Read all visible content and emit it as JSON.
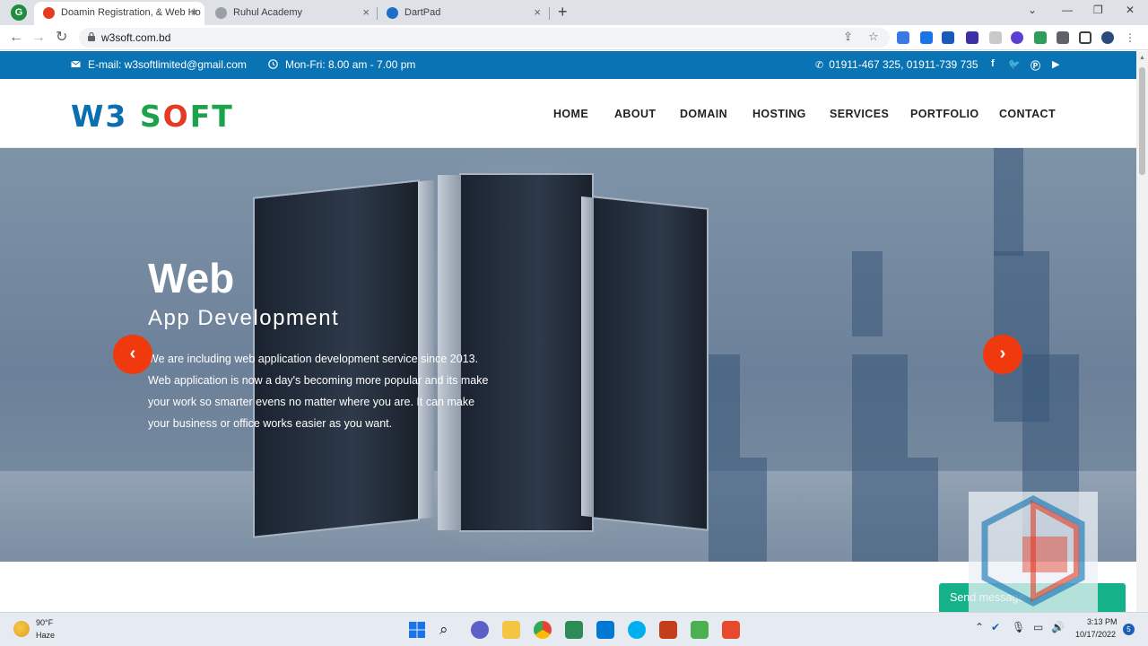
{
  "browser": {
    "tabs": [
      {
        "title": "Doamin Registration, & Web Ho",
        "active": true
      },
      {
        "title": "Ruhul Academy",
        "active": false
      },
      {
        "title": "DartPad",
        "active": false
      }
    ],
    "close_glyph": "×",
    "new_tab_glyph": "+",
    "url": "w3soft.com.bd"
  },
  "site": {
    "topbar": {
      "email": "E-mail: w3softlimited@gmail.com",
      "hours": "Mon-Fri: 8.00 am - 7.00 pm",
      "phone": "01911-467 325, 01911-739 735"
    },
    "logo": {
      "w3": "W3",
      "s": "S",
      "o": "O",
      "ft": "FT"
    },
    "menu": [
      "HOME",
      "ABOUT",
      "DOMAIN",
      "HOSTING",
      "SERVICES",
      "PORTFOLIO",
      "CONTACT"
    ],
    "hero": {
      "title": "Web",
      "subtitle": "App Development",
      "text": "We are including web application development service since 2013. Web application is now a day's becoming more popular and its make your work so smarter evens no matter where you are. It can make your business or office works easier as you want."
    },
    "chat": {
      "label": "Send message"
    }
  },
  "taskbar": {
    "weather_temp": "90°F",
    "weather_desc": "Haze",
    "time": "3:13 PM",
    "date": "10/17/2022",
    "notifications": "5"
  },
  "colors": {
    "topbar": "#0a73b4",
    "accent_orange": "#f03a0d",
    "logo_blue": "#0a6fb0",
    "logo_green": "#1aa34a",
    "chat_green": "#15b28a"
  }
}
